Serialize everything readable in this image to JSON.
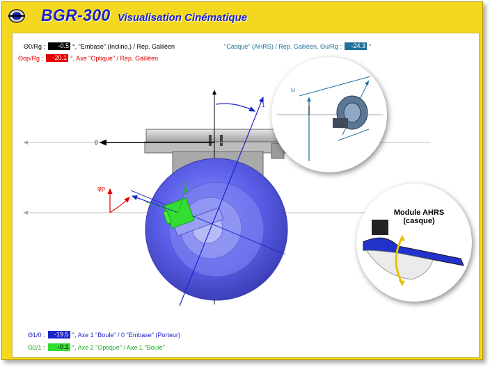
{
  "window": {
    "title": "BGR-300",
    "subtitle": "Visualisation Cinématique"
  },
  "readouts": {
    "theta0": {
      "label": "Θ0/Rg :",
      "value": "-0.5",
      "desc": "°, \"Embase\" (Inclino.) / Rep. Galiléen",
      "color": "#000000",
      "bg": "#000000",
      "fg": "#ffffff"
    },
    "thetaop": {
      "label": "Θop/Rg :",
      "value": "-20.1",
      "desc": "°, Axe \"Optique\" / Rep. Galiléen",
      "color": "#e00000",
      "bg": "#e00000",
      "fg": "#ffffff"
    },
    "thetau": {
      "label": "\"Casque\" (AHRS) / Rep. Galiléen, Θu/Rg :",
      "value": "-24.3",
      "unit": "°",
      "color": "#1f6f9a",
      "bg": "#1f6f9a",
      "fg": "#ffffff"
    },
    "theta10": {
      "label": "Θ1/0 :",
      "value": "-19.5",
      "desc": "°, Axe 1 \"Boule\" / 0 \"Embase\" (Porteur)",
      "color": "#1a24c8",
      "bg": "#1a24c8",
      "fg": "#ffffff"
    },
    "theta21": {
      "label": "Θ2/1 :",
      "value": "-0.1",
      "desc": "°, Axe 2 \"Optique\" / Axe 1 \"Boule\"",
      "color": "#22bb22",
      "bg": "#33dd33",
      "fg": "#000000"
    }
  },
  "diagram": {
    "axis_0_label": "0",
    "axis_1_label": "1",
    "axis_2_label": "2",
    "axis_op_label": "φp",
    "axis_u_label": "u"
  },
  "module": {
    "line1": "Module AHRS",
    "line2": "(casque)"
  },
  "colors": {
    "frame": "#f4d81f",
    "title": "#1a24c8",
    "sphere": "#5a5ee8",
    "embase": "#c8c8c8",
    "optique": "#33dd33"
  }
}
